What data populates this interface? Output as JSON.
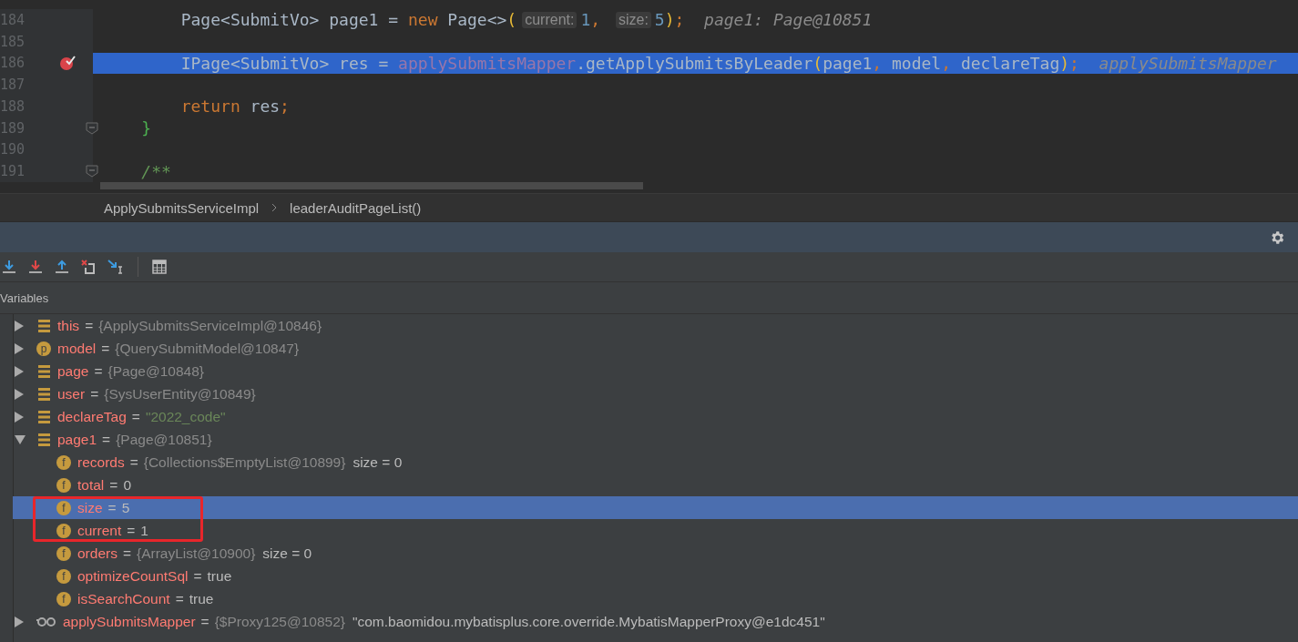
{
  "editor": {
    "lines": [
      {
        "number": "184",
        "breakpoint": false,
        "fold": false,
        "selected": false,
        "tokens": [
          {
            "kind": "plain",
            "text": "        Page<SubmitVo> page1 = "
          },
          {
            "kind": "keyword",
            "text": "new"
          },
          {
            "kind": "plain",
            "text": " Page<>"
          },
          {
            "kind": "paren",
            "text": "("
          },
          {
            "kind": "hint",
            "text": "current:"
          },
          {
            "kind": "number",
            "text": "1"
          },
          {
            "kind": "comma",
            "text": ", "
          },
          {
            "kind": "hint",
            "text": "size:"
          },
          {
            "kind": "number",
            "text": "5"
          },
          {
            "kind": "paren",
            "text": ")"
          },
          {
            "kind": "comma",
            "text": ";"
          },
          {
            "kind": "debug",
            "text": "  page1: Page@10851"
          }
        ]
      },
      {
        "number": "185",
        "breakpoint": false,
        "fold": false,
        "selected": false
      },
      {
        "number": "186",
        "breakpoint": true,
        "fold": false,
        "selected": true,
        "tokens": [
          {
            "kind": "plain",
            "text": "        IPage<SubmitVo> res = "
          },
          {
            "kind": "field",
            "text": "applySubmitsMapper"
          },
          {
            "kind": "plain",
            "text": ".getApplySubmitsByLeader"
          },
          {
            "kind": "paren",
            "text": "("
          },
          {
            "kind": "plain",
            "text": "page1"
          },
          {
            "kind": "comma",
            "text": ", "
          },
          {
            "kind": "plain",
            "text": "model"
          },
          {
            "kind": "comma",
            "text": ", "
          },
          {
            "kind": "plain",
            "text": "declareTag"
          },
          {
            "kind": "paren",
            "text": ")"
          },
          {
            "kind": "comma",
            "text": ";"
          },
          {
            "kind": "debug",
            "text": "  applySubmitsMapper"
          }
        ]
      },
      {
        "number": "187",
        "breakpoint": false,
        "fold": false,
        "selected": false
      },
      {
        "number": "188",
        "breakpoint": false,
        "fold": false,
        "selected": false,
        "tokens": [
          {
            "kind": "keyword",
            "text": "        return"
          },
          {
            "kind": "plain",
            "text": " res"
          },
          {
            "kind": "comma",
            "text": ";"
          }
        ]
      },
      {
        "number": "189",
        "breakpoint": false,
        "fold": true,
        "selected": false,
        "tokens": [
          {
            "kind": "brace",
            "text": "    }"
          }
        ]
      },
      {
        "number": "190",
        "breakpoint": false,
        "fold": false,
        "selected": false
      },
      {
        "number": "191",
        "breakpoint": false,
        "fold": true,
        "selected": false,
        "tokens": [
          {
            "kind": "comment",
            "text": "    /**"
          }
        ]
      }
    ]
  },
  "breadcrumbs": [
    "ApplySubmitsServiceImpl",
    "leaderAuditPageList()"
  ],
  "panel_title": "Variables",
  "variables": [
    {
      "kind": "list",
      "name": "this",
      "equals": "=",
      "value": {
        "kind": "ref",
        "text": "{ApplySubmitsServiceImpl@10846}"
      },
      "expanded": false,
      "selected": false,
      "outlined": false
    },
    {
      "kind": "param",
      "badge": "p",
      "name": "model",
      "equals": "=",
      "value": {
        "kind": "ref",
        "text": "{QuerySubmitModel@10847}"
      },
      "expanded": false,
      "selected": false,
      "outlined": false
    },
    {
      "kind": "list",
      "name": "page",
      "equals": "=",
      "value": {
        "kind": "ref",
        "text": "{Page@10848}"
      },
      "expanded": false,
      "selected": false,
      "outlined": false
    },
    {
      "kind": "list",
      "name": "user",
      "equals": "=",
      "value": {
        "kind": "ref",
        "text": "{SysUserEntity@10849}"
      },
      "expanded": false,
      "selected": false,
      "outlined": false
    },
    {
      "kind": "list",
      "name": "declareTag",
      "equals": "=",
      "value": {
        "kind": "string",
        "text": "\"2022_code\""
      },
      "expanded": false,
      "selected": false,
      "outlined": false
    },
    {
      "kind": "list",
      "name": "page1",
      "equals": "=",
      "value": {
        "kind": "ref",
        "text": "{Page@10851}"
      },
      "expanded": true,
      "selected": false,
      "outlined": false,
      "children": [
        {
          "kind": "field",
          "badge": "f",
          "name": "records",
          "equals": "=",
          "value": {
            "kind": "ref",
            "text": "{Collections$EmptyList@10899}"
          },
          "extra": "size = 0",
          "selected": false,
          "outlined": false
        },
        {
          "kind": "field",
          "badge": "f",
          "name": "total",
          "equals": "=",
          "value": {
            "kind": "plain",
            "text": "0"
          },
          "selected": false,
          "outlined": false
        },
        {
          "kind": "field",
          "badge": "f",
          "name": "size",
          "equals": "=",
          "value": {
            "kind": "plain",
            "text": "5"
          },
          "selected": true,
          "outlined": true
        },
        {
          "kind": "field",
          "badge": "f",
          "name": "current",
          "equals": "=",
          "value": {
            "kind": "plain",
            "text": "1"
          },
          "selected": false,
          "outlined": true
        },
        {
          "kind": "field",
          "badge": "f",
          "name": "orders",
          "equals": "=",
          "value": {
            "kind": "ref",
            "text": "{ArrayList@10900}"
          },
          "extra": "size = 0",
          "selected": false,
          "outlined": false
        },
        {
          "kind": "field",
          "badge": "f",
          "name": "optimizeCountSql",
          "equals": "=",
          "value": {
            "kind": "plain",
            "text": "true"
          },
          "selected": false,
          "outlined": false
        },
        {
          "kind": "field",
          "badge": "f",
          "name": "isSearchCount",
          "equals": "=",
          "value": {
            "kind": "plain",
            "text": "true"
          },
          "selected": false,
          "outlined": false
        }
      ]
    },
    {
      "kind": "watch",
      "name": "applySubmitsMapper",
      "equals": "=",
      "value": {
        "kind": "ref",
        "text": "{$Proxy125@10852}"
      },
      "extra": "\"com.baomidou.mybatisplus.core.override.MybatisMapperProxy@e1dc451\"",
      "expanded": false,
      "selected": false,
      "outlined": false
    }
  ]
}
